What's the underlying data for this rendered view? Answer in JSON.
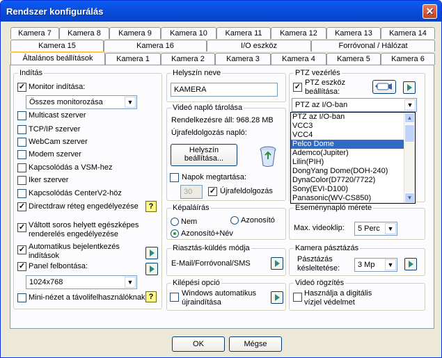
{
  "window": {
    "title": "Rendszer konfigurálás"
  },
  "tabs_row1": [
    "Kamera 7",
    "Kamera 8",
    "Kamera 9",
    "Kamera 10",
    "Kamera 11",
    "Kamera 12",
    "Kamera 13",
    "Kamera 14"
  ],
  "tabs_row2": [
    "Kamera 15",
    "Kamera 16",
    "I/O eszköz",
    "Forróvonal / Hálózat"
  ],
  "tabs_row3": [
    "Általános beállítások",
    "Kamera 1",
    "Kamera 2",
    "Kamera 3",
    "Kamera 4",
    "Kamera 5",
    "Kamera 6"
  ],
  "inditas": {
    "legend": "Indítás",
    "monitor_inditasa": "Monitor indítása:",
    "monitor_select": "Összes monitorozása",
    "multicast": "Multicast szerver",
    "tcpip": "TCP/IP szerver",
    "webcam": "WebCam szerver",
    "modem": "Modem szerver",
    "vsm": "Kapcsolódás a VSM-hez",
    "iker": "Iker szerver",
    "centerv2": "Kapcsolódás CenterV2-höz",
    "directdraw": "Directdraw réteg engedélyezése",
    "valtott1": "Váltott soros helyett egészképes",
    "valtott2": "renderelés engedélyezése",
    "auto1": "Automatikus bejelentkezés",
    "auto2": "indítások",
    "panel": "Panel felbontása:",
    "panel_select": "1024x768",
    "mini": "Mini-nézet a távolifelhasználóknak"
  },
  "helyszin": {
    "legend": "Helyszín neve",
    "value": "KAMERA"
  },
  "video_naplo": {
    "legend": "Videó napló tárolása",
    "rendelkezesre": "Rendelkezésre áll: 968.28 MB",
    "ujra": "Újrafeldolgozás napló:",
    "btn1": "Helyszín",
    "btn2": "beállítása...",
    "napok": "Napok megtartása:",
    "napok_value": "30",
    "ujrafeldolgozas": "Újrafeldolgozás"
  },
  "ptz": {
    "legend": "PTZ vezérlés",
    "label1": "PTZ eszköz",
    "label2": "beállítása:",
    "select": "PTZ az I/O-ban",
    "options": [
      "PTZ az I/O-ban",
      "VCC3",
      "VCC4",
      "Pelco Dome",
      "Ademco(Jupiter)",
      "Lilin(PIH)",
      "DongYang Dome(DOH-240)",
      "DynaColor(D7720/7722)",
      "Sony(EVI-D100)",
      "Panasonic(WV-CS850)"
    ],
    "selected_index": 3
  },
  "kepalairas": {
    "legend": "Képaláírás",
    "nem": "Nem",
    "azonosito": "Azonosító",
    "azonosito_nev": "Azonosító+Név"
  },
  "esemenynaplo": {
    "legend": "Eseménynapló mérete",
    "label": "Max. videoklip:",
    "select": "5 Perc"
  },
  "riasztas": {
    "legend": "Riasztás-küldés módja",
    "label": "E-Mail/Forróvonal/SMS"
  },
  "kamera_pasztazas": {
    "legend": "Kamera pásztázás",
    "label1": "Pásztázás",
    "label2": "késleltetése:",
    "select": "3 Mp"
  },
  "kilepesi": {
    "legend": "Kilépési opció",
    "label1": "Windows automatikus",
    "label2": "újraindítása"
  },
  "video_rogzites": {
    "legend": "Videó rögzítés",
    "label1": "Használja a digitális",
    "label2": "vízjel védelmet"
  },
  "footer": {
    "ok": "OK",
    "megse": "Mégse"
  }
}
